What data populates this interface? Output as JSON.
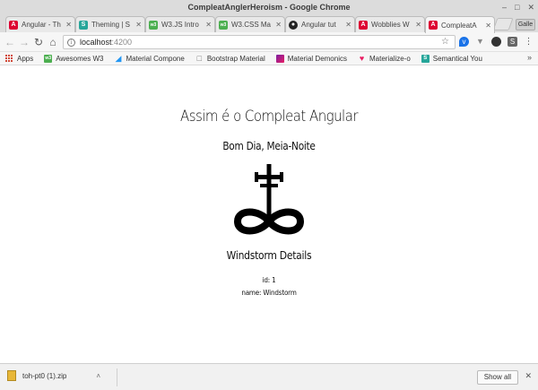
{
  "window": {
    "title": "CompleatAnglerHeroism - Google Chrome",
    "controls": [
      "–",
      "□",
      "✕"
    ]
  },
  "tabs": [
    {
      "label": "Angular - Th",
      "favicon": "A",
      "favicon_color": "#dd0031",
      "active": false
    },
    {
      "label": "Theming | S",
      "favicon": "S",
      "favicon_color": "#26a69a",
      "active": false
    },
    {
      "label": "W3.JS Intro",
      "favicon": "w3",
      "favicon_color": "#4caf50",
      "active": false
    },
    {
      "label": "W3.CSS Ma",
      "favicon": "w3",
      "favicon_color": "#4caf50",
      "active": false
    },
    {
      "label": "Angular tut",
      "favicon": "●",
      "favicon_color": "#222222",
      "active": false
    },
    {
      "label": "Wobblies W",
      "favicon": "A",
      "favicon_color": "#dd0031",
      "active": false
    },
    {
      "label": "CompleatA",
      "favicon": "A",
      "favicon_color": "#dd0031",
      "active": true
    }
  ],
  "profile_button": "Galle",
  "toolbar": {
    "back_icon": "←",
    "forward_icon": "→",
    "reload_icon": "↻",
    "home_icon": "⌂",
    "url_host": "localhost",
    "url_port": ":4200",
    "star_icon": "☆"
  },
  "bookmarks": [
    {
      "label": "Apps",
      "icon": "apps-grid",
      "color": "#d14836"
    },
    {
      "label": "Awesomes W3",
      "icon": "w3",
      "color": "#4caf50"
    },
    {
      "label": "Material Compone",
      "icon": "◢",
      "color": "#2196f3"
    },
    {
      "label": "Bootstrap Material",
      "icon": "□",
      "color": "#777777"
    },
    {
      "label": "Material Demonics",
      "icon": "■",
      "color": "#7b1fa2"
    },
    {
      "label": "Materialize-o",
      "icon": "♥",
      "color": "#e91e63"
    },
    {
      "label": "Semantical You",
      "icon": "S",
      "color": "#26a69a"
    }
  ],
  "page": {
    "title": "Assim é o Compleat Angular",
    "greeting": "Bom Dia, Meia-Noite",
    "hero_heading": "Windstorm Details",
    "hero_id": "id: 1",
    "hero_name": "name: Windstorm"
  },
  "downloads": {
    "filename": "toh-pt0 (1).zip",
    "show_all": "Show all",
    "caret": "˄",
    "close": "✕"
  }
}
